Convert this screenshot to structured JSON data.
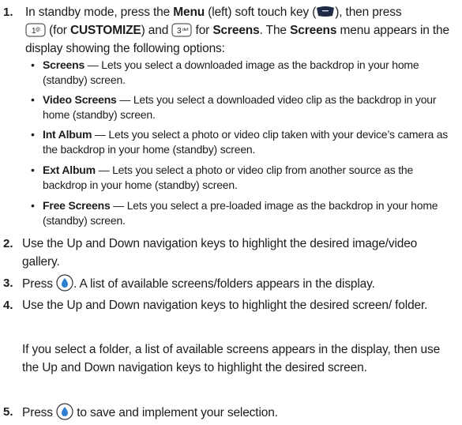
{
  "steps": [
    {
      "number": "1.",
      "t1": "In standby mode, press the ",
      "b1": "Menu",
      "t2": " (left) soft touch key (",
      "t3": "), then press",
      "t4": " (for ",
      "b2": "CUSTOMIZE",
      "t5": ") and ",
      "t6": " for ",
      "b3": "Screens",
      "t7": ". The ",
      "b4": "Screens",
      "t8": " menu appears in the display showing the following options:",
      "key1_label": "1",
      "key1_sub": "@.",
      "key3_label": "3",
      "key3_sub": "def"
    },
    {
      "number": "2.",
      "text": "Use the Up and Down navigation keys to highlight the desired image/video gallery."
    },
    {
      "number": "3.",
      "t1": "Press ",
      "t2": ". A list of available screens/folders appears in the display."
    },
    {
      "number": "4.",
      "text": "Use the Up and Down navigation keys to highlight the desired screen/ folder.",
      "extra": "If you select a folder, a list of available screens appears in the display, then use the Up and Down navigation keys to highlight the desired screen."
    },
    {
      "number": "5.",
      "t1": "Press ",
      "t2": " to save and implement your selection."
    }
  ],
  "options": [
    {
      "term": "Screens",
      "desc": " — Lets you select a downloaded image as the backdrop in your home (standby) screen."
    },
    {
      "term": "Video Screens",
      "desc": " — Lets you select a downloaded video clip as the backdrop in your home (standby) screen."
    },
    {
      "term": "Int Album",
      "desc": " — Lets you select a photo or video clip taken with your device’s camera as the backdrop in your home (standby) screen."
    },
    {
      "term": "Ext Album",
      "desc": " — Lets you select a photo or video clip from another source as the backdrop in your home (standby) screen."
    },
    {
      "term": "Free Screens",
      "desc": " — Lets you select a pre-loaded image as the backdrop in your home (standby) screen."
    }
  ],
  "bullet_char": "•",
  "colors": {
    "text": "#1c1c1c",
    "ok_key_blue": "#2f7fd0",
    "softkey_dark": "#1f2a44"
  }
}
